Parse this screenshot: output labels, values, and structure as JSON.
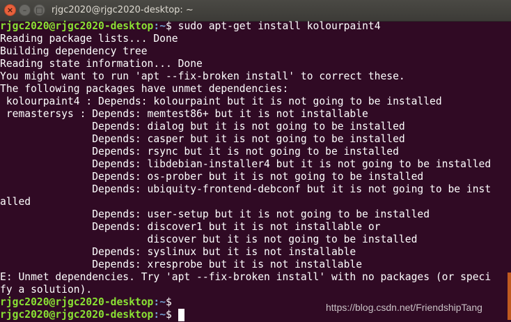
{
  "window": {
    "title": "rjgc2020@rjgc2020-desktop: ~",
    "close_glyph": "×",
    "minimize_glyph": "–",
    "maximize_glyph": "□"
  },
  "terminal": {
    "background": "#300a24",
    "prompt_user_color": "#8ae234",
    "prompt_path_color": "#729fcf",
    "lines": [
      {
        "user": "rjgc2020@rjgc2020-desktop",
        "path": ":~",
        "text": "$ sudo apt-get install kolourpaint4"
      },
      {
        "text": "Reading package lists... Done"
      },
      {
        "text": "Building dependency tree"
      },
      {
        "text": "Reading state information... Done"
      },
      {
        "text": "You might want to run 'apt --fix-broken install' to correct these."
      },
      {
        "text": "The following packages have unmet dependencies:"
      },
      {
        "text": " kolourpaint4 : Depends: kolourpaint but it is not going to be installed"
      },
      {
        "text": " remastersys : Depends: memtest86+ but it is not installable"
      },
      {
        "text": "               Depends: dialog but it is not going to be installed"
      },
      {
        "text": "               Depends: casper but it is not going to be installed"
      },
      {
        "text": "               Depends: rsync but it is not going to be installed"
      },
      {
        "text": "               Depends: libdebian-installer4 but it is not going to be installed"
      },
      {
        "text": "               Depends: os-prober but it is not going to be installed"
      },
      {
        "text": "               Depends: ubiquity-frontend-debconf but it is not going to be inst"
      },
      {
        "text": "alled"
      },
      {
        "text": "               Depends: user-setup but it is not going to be installed"
      },
      {
        "text": "               Depends: discover1 but it is not installable or"
      },
      {
        "text": "                        discover but it is not going to be installed"
      },
      {
        "text": "               Depends: syslinux but it is not installable"
      },
      {
        "text": "               Depends: xresprobe but it is not installable"
      },
      {
        "text": "E: Unmet dependencies. Try 'apt --fix-broken install' with no packages (or speci"
      },
      {
        "text": "fy a solution)."
      },
      {
        "user": "rjgc2020@rjgc2020-desktop",
        "path": ":~",
        "text": "$"
      },
      {
        "user": "rjgc2020@rjgc2020-desktop",
        "path": ":~",
        "text": "$ ",
        "cursor": true
      }
    ]
  },
  "watermark": "https://blog.csdn.net/FriendshipTang"
}
